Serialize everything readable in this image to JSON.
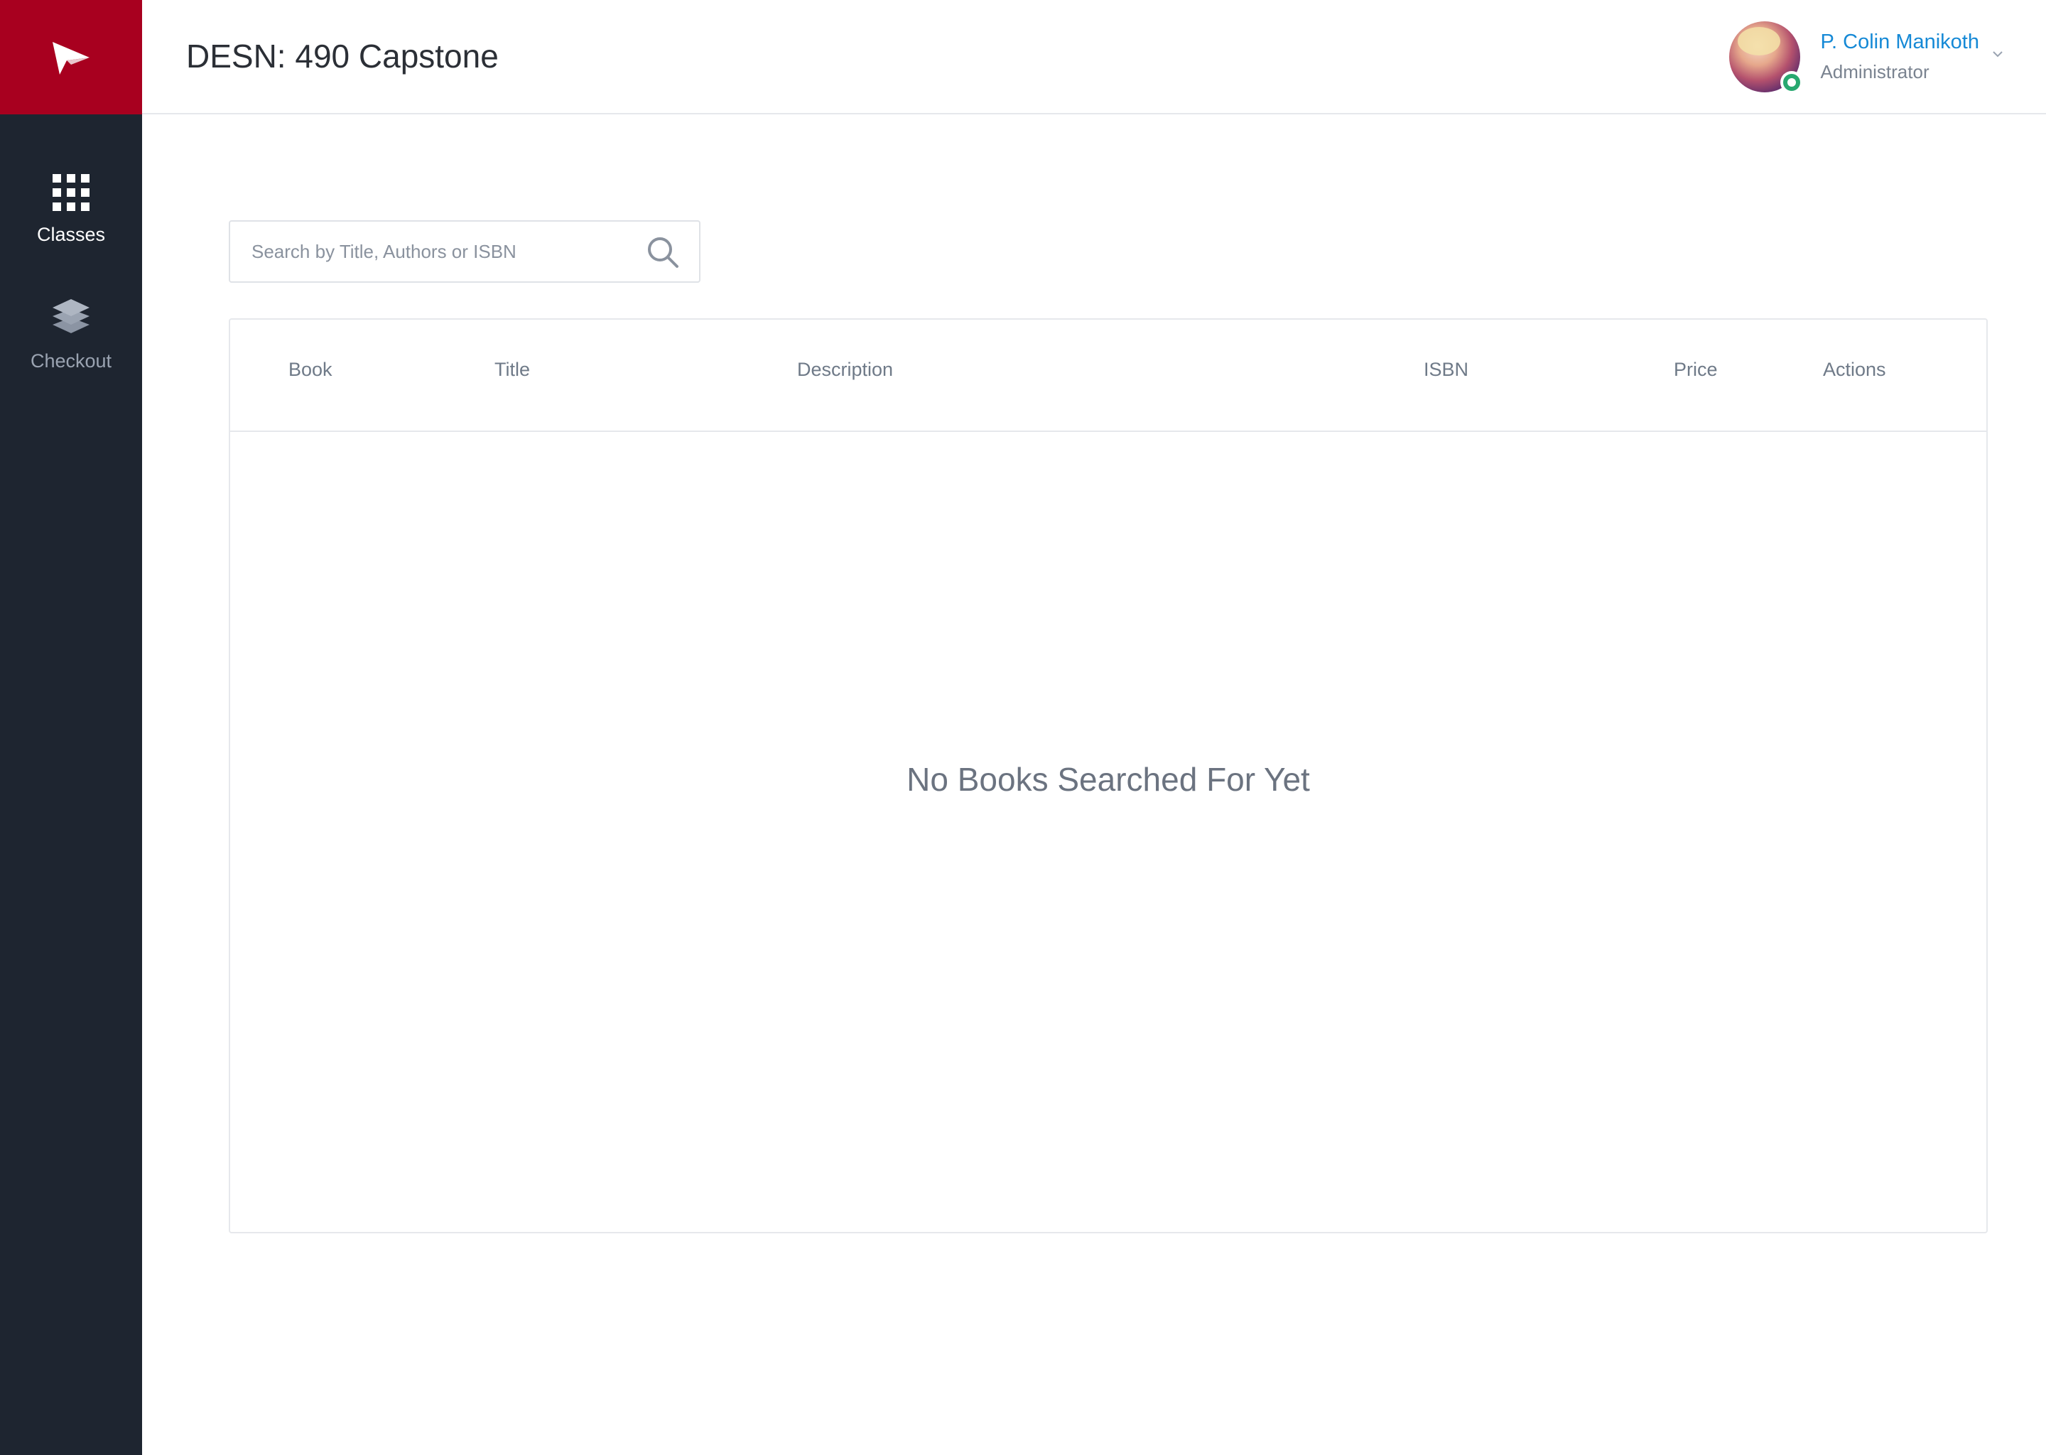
{
  "sidebar": {
    "brand_icon": "paper-plane-icon",
    "items": [
      {
        "label": "Classes",
        "icon": "grid-icon",
        "active": true
      },
      {
        "label": "Checkout",
        "icon": "layers-icon",
        "active": false
      }
    ]
  },
  "header": {
    "title": "DESN: 490 Capstone",
    "user": {
      "name": "P. Colin Manikoth",
      "role": "Administrator",
      "status": "online"
    }
  },
  "search": {
    "placeholder": "Search by Title, Authors or ISBN",
    "value": ""
  },
  "table": {
    "columns": [
      "Book",
      "Title",
      "Description",
      "ISBN",
      "Price",
      "Actions"
    ],
    "rows": [],
    "empty_message": "No Books Searched For Yet"
  },
  "colors": {
    "brand_red": "#a8001f",
    "sidebar_bg": "#1e2530",
    "link_blue": "#1589d6",
    "status_green": "#28a870"
  }
}
